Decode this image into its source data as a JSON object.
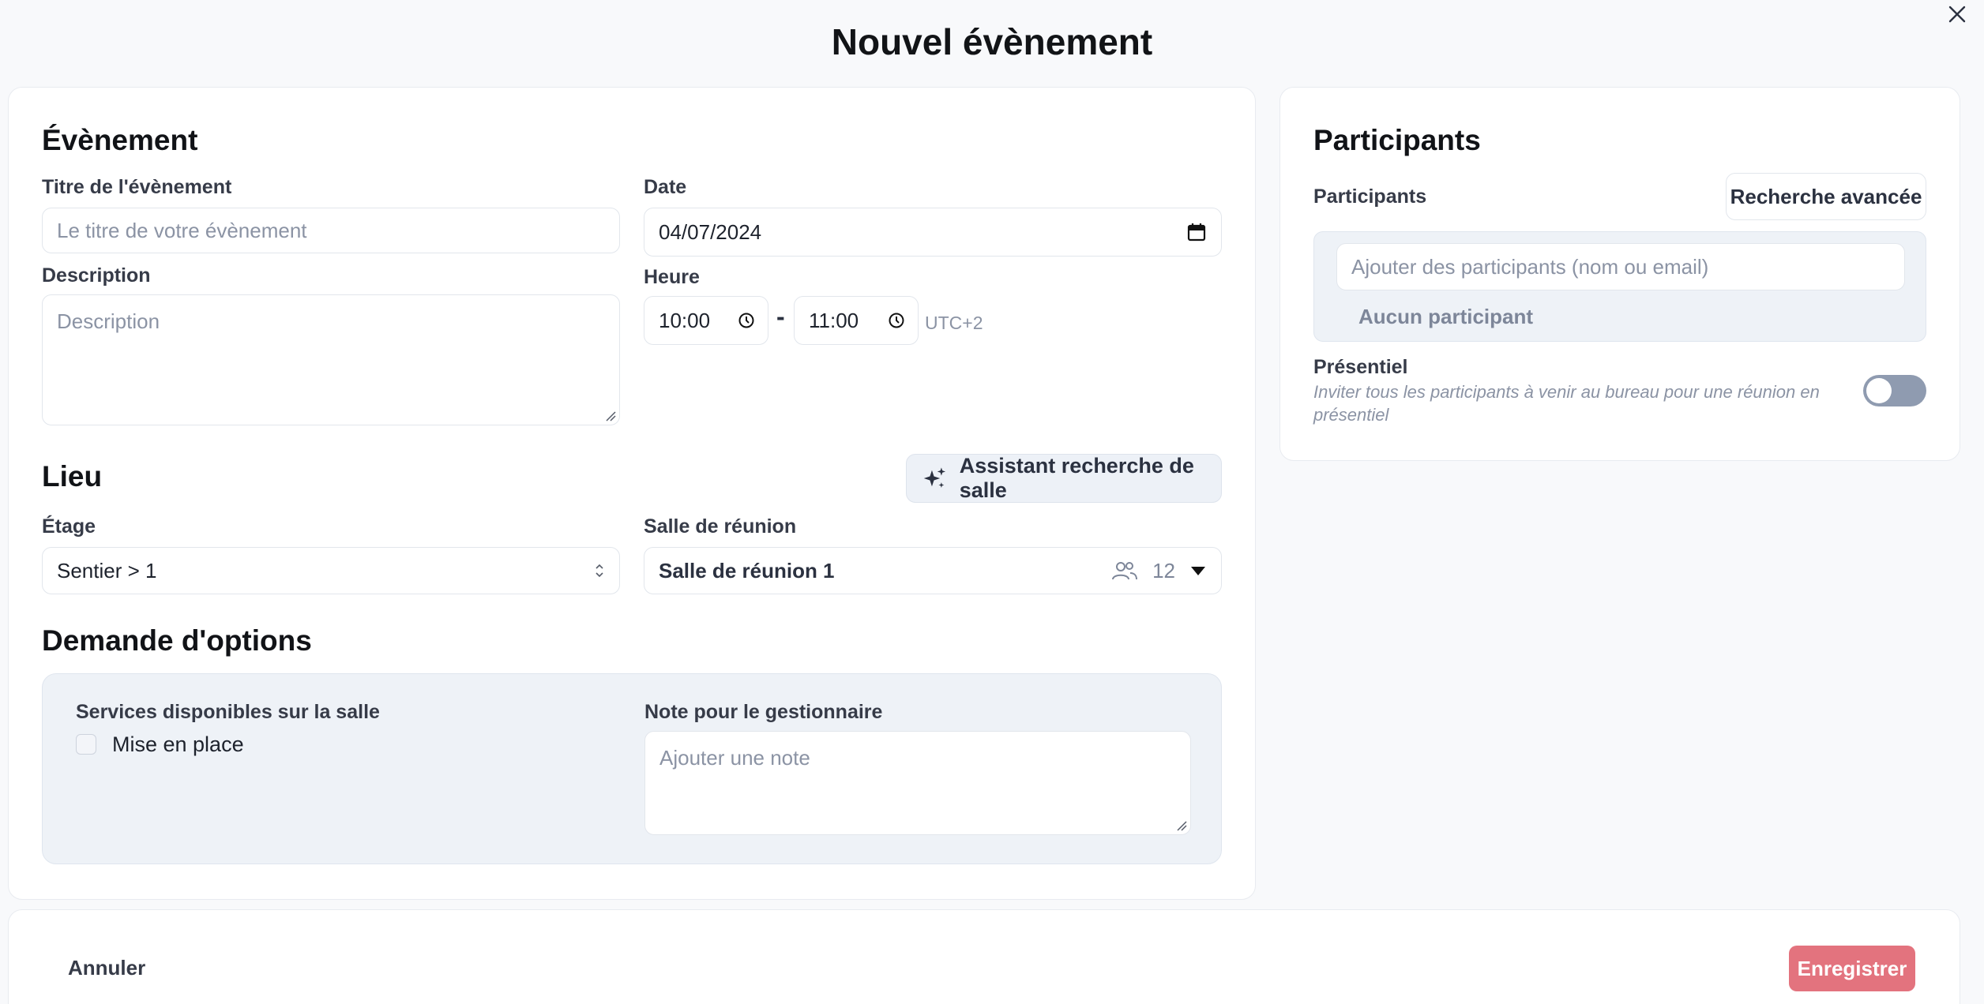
{
  "modal": {
    "title": "Nouvel évènement"
  },
  "event": {
    "section_title": "Évènement",
    "title_label": "Titre de l'évènement",
    "title_placeholder": "Le titre de votre évènement",
    "description_label": "Description",
    "description_placeholder": "Description",
    "date_label": "Date",
    "date_value": "04/07/2024",
    "time_label": "Heure",
    "start_time": "10:00",
    "end_time": "11:00",
    "time_separator": "-",
    "timezone": "UTC+2"
  },
  "location": {
    "section_title": "Lieu",
    "assistant_button": "Assistant recherche de salle",
    "floor_label": "Étage",
    "floor_value": "Sentier > 1",
    "room_label": "Salle de réunion",
    "room_value": "Salle de réunion 1",
    "room_capacity": "12"
  },
  "options": {
    "section_title": "Demande d'options",
    "services_label": "Services disponibles sur la salle",
    "service_item": "Mise en place",
    "service_checked": false,
    "note_label": "Note pour le gestionnaire",
    "note_placeholder": "Ajouter une note"
  },
  "participants": {
    "section_title": "Participants",
    "field_label": "Participants",
    "advanced_search_button": "Recherche avancée",
    "add_placeholder": "Ajouter des participants (nom ou email)",
    "empty_text": "Aucun participant",
    "in_person_label": "Présentiel",
    "in_person_description": "Inviter tous les participants à venir au bureau pour une réunion en présentiel",
    "in_person_enabled": false
  },
  "footer": {
    "cancel_label": "Annuler",
    "save_label": "Enregistrer"
  },
  "colors": {
    "save_button": "#e3737e",
    "toggle_off": "#8f9bb0",
    "panel_bg": "#eef2f7"
  }
}
